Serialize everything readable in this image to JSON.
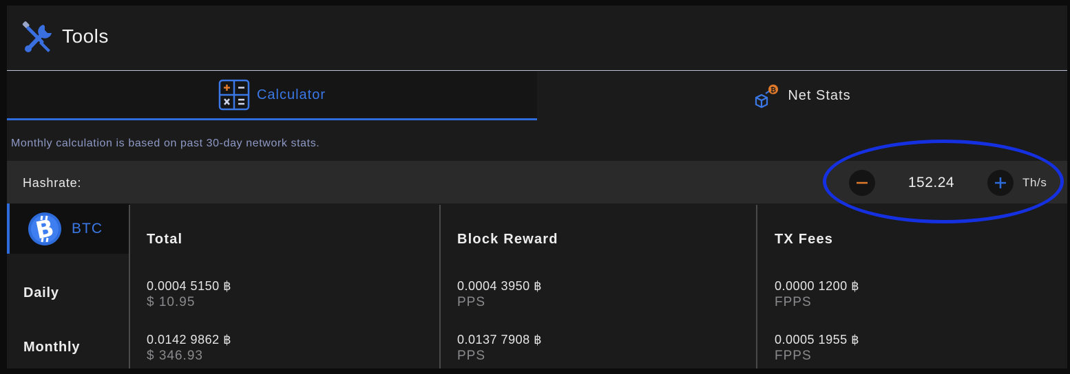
{
  "header": {
    "title": "Tools",
    "icon": "tools-icon"
  },
  "tabs": [
    {
      "label": "Calculator",
      "icon": "calculator-icon",
      "active": true
    },
    {
      "label": "Net Stats",
      "icon": "net-stats-icon",
      "active": false
    }
  ],
  "note": "Monthly calculation is based on past 30-day network stats.",
  "hashrate": {
    "label": "Hashrate:",
    "value": "152.24",
    "unit": "Th/s"
  },
  "coin": {
    "label": "BTC",
    "icon": "bitcoin-icon"
  },
  "periods": [
    "Daily",
    "Monthly"
  ],
  "columns": [
    {
      "header": "Total",
      "rows": [
        {
          "amount": "0.0004 5150 ฿",
          "sub": "$ 10.95"
        },
        {
          "amount": "0.0142 9862 ฿",
          "sub": "$ 346.93"
        }
      ]
    },
    {
      "header": "Block Reward",
      "rows": [
        {
          "amount": "0.0004 3950 ฿",
          "sub": "PPS"
        },
        {
          "amount": "0.0137 7908 ฿",
          "sub": "PPS"
        }
      ]
    },
    {
      "header": "TX Fees",
      "rows": [
        {
          "amount": "0.0000 1200 ฿",
          "sub": "FPPS"
        },
        {
          "amount": "0.0005 1955 ฿",
          "sub": "FPPS"
        }
      ]
    }
  ],
  "colors": {
    "accent": "#2f6cdb",
    "highlight_ring": "#1530e0",
    "minus": "#e07a2a",
    "plus": "#2f6cdb",
    "background": "#1b1b1c"
  }
}
